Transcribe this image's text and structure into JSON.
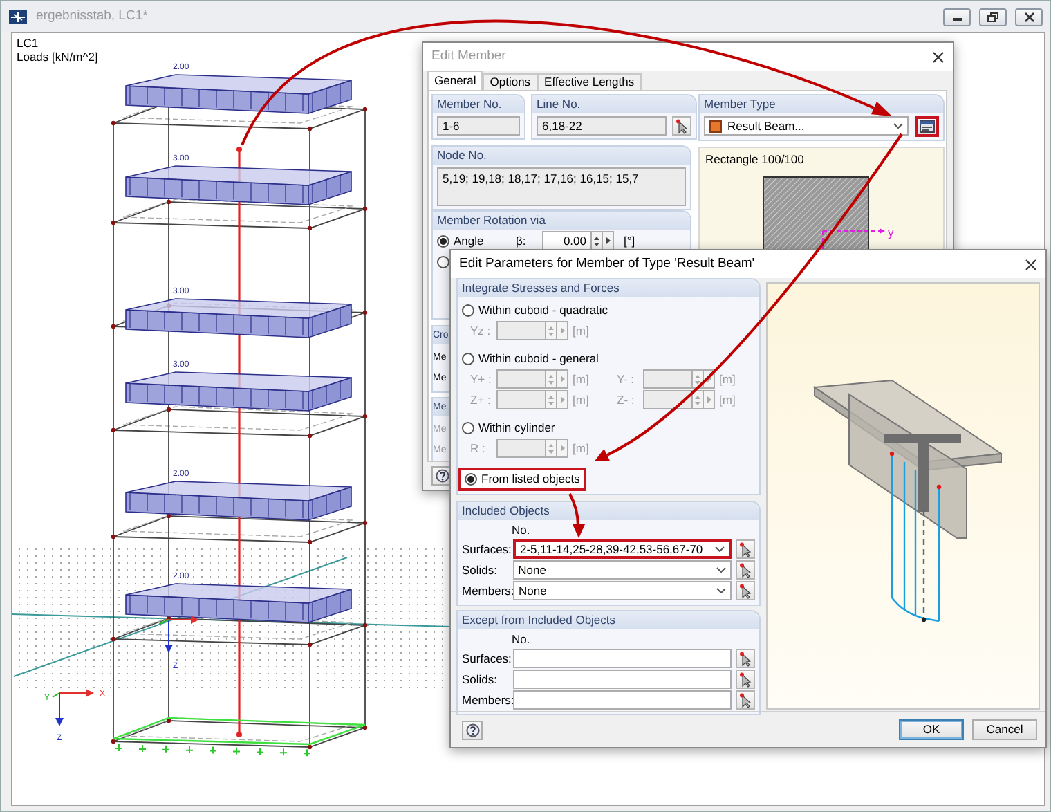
{
  "window": {
    "title": "ergebnisstab, LC1*"
  },
  "canvas": {
    "case": "LC1",
    "units": "Loads [kN/m^2]",
    "load_values": [
      "2.00",
      "3.00",
      "3.00",
      "3.00",
      "2.00",
      "2.00"
    ],
    "member_axis_label": "Z",
    "axes": [
      "X",
      "Y",
      "Z"
    ]
  },
  "edit_member": {
    "title": "Edit Member",
    "tabs": [
      {
        "label": "General",
        "selected": true
      },
      {
        "label": "Options",
        "selected": false
      },
      {
        "label": "Effective Lengths",
        "selected": false
      }
    ],
    "member_no": {
      "label": "Member No.",
      "value": "1-6"
    },
    "line_no": {
      "label": "Line No.",
      "value": "6,18-22"
    },
    "member_type": {
      "label": "Member Type",
      "value": "Result Beam...",
      "highlighted": true
    },
    "node_no": {
      "label": "Node No.",
      "value": "5,19; 19,18; 18,17; 17,16; 16,15; 15,7"
    },
    "rotation": {
      "label": "Member Rotation via",
      "options": [
        {
          "label": "Angle",
          "selected": true
        },
        {
          "selected": false
        }
      ],
      "beta_label": "β:",
      "beta_value": "0.00",
      "beta_unit": "[°]"
    },
    "section_preview": {
      "label": "Rectangle 100/100",
      "axis_label": "y"
    },
    "hidden_groups": [
      {
        "label": "Cro",
        "rows": [
          {
            "label": "Me",
            "disabled": false
          },
          {
            "label": "Me",
            "disabled": false
          }
        ]
      },
      {
        "label": "Me",
        "rows": [
          {
            "label": "Me",
            "disabled": true
          },
          {
            "label": "Me",
            "disabled": true
          }
        ]
      }
    ]
  },
  "edit_parameters": {
    "title": "Edit Parameters for Member of Type 'Result Beam'",
    "integrate": {
      "label": "Integrate Stresses and Forces",
      "methods": [
        {
          "label": "Within cuboid - quadratic",
          "selected": false,
          "highlighted": false,
          "fields": [
            {
              "label": "Yz :",
              "unit": "[m]"
            }
          ]
        },
        {
          "label": "Within cuboid - general",
          "selected": false,
          "highlighted": false,
          "fields": [
            {
              "label": "Y+ :",
              "unit": "[m]"
            },
            {
              "label": "Y- :",
              "unit": "[m]"
            },
            {
              "label": "Z+ :",
              "unit": "[m]"
            },
            {
              "label": "Z- :",
              "unit": "[m]"
            }
          ]
        },
        {
          "label": "Within cylinder",
          "selected": false,
          "highlighted": false,
          "fields": [
            {
              "label": "R :",
              "unit": "[m]"
            }
          ]
        },
        {
          "label": "From listed objects",
          "selected": true,
          "highlighted": true
        }
      ]
    },
    "included": {
      "label": "Included Objects",
      "column": "No.",
      "rows": [
        {
          "label": "Surfaces:",
          "value": "2-5,11-14,25-28,39-42,53-56,67-70",
          "highlighted": true
        },
        {
          "label": "Solids:",
          "value": "None",
          "highlighted": false
        },
        {
          "label": "Members:",
          "value": "None",
          "highlighted": false
        }
      ]
    },
    "excluded": {
      "label": "Except from Included Objects",
      "column": "No.",
      "rows": [
        {
          "label": "Surfaces:"
        },
        {
          "label": "Solids:"
        },
        {
          "label": "Members:"
        }
      ]
    },
    "buttons": [
      {
        "label": "OK",
        "default": true
      },
      {
        "label": "Cancel",
        "default": false
      }
    ]
  }
}
